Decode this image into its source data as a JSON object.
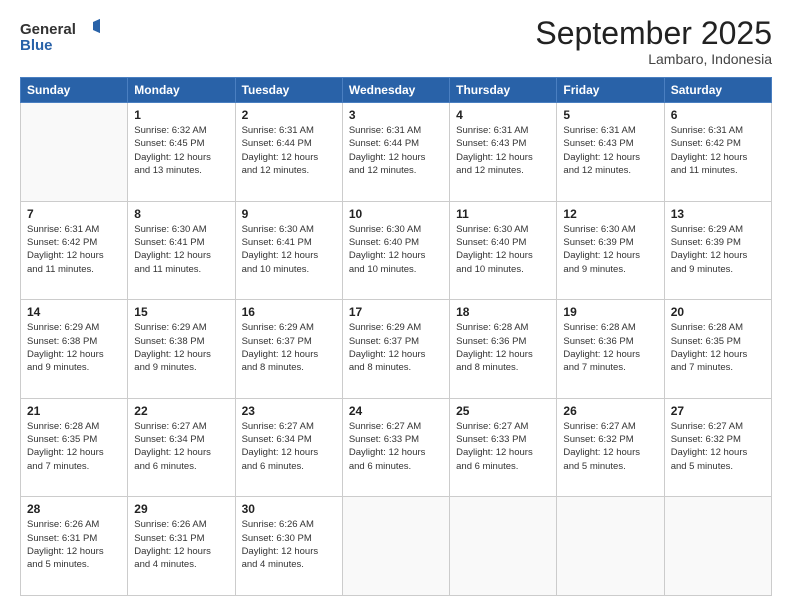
{
  "header": {
    "logo_line1": "General",
    "logo_line2": "Blue",
    "month": "September 2025",
    "location": "Lambaro, Indonesia"
  },
  "days_of_week": [
    "Sunday",
    "Monday",
    "Tuesday",
    "Wednesday",
    "Thursday",
    "Friday",
    "Saturday"
  ],
  "weeks": [
    [
      {
        "day": "",
        "info": ""
      },
      {
        "day": "1",
        "info": "Sunrise: 6:32 AM\nSunset: 6:45 PM\nDaylight: 12 hours\nand 13 minutes."
      },
      {
        "day": "2",
        "info": "Sunrise: 6:31 AM\nSunset: 6:44 PM\nDaylight: 12 hours\nand 12 minutes."
      },
      {
        "day": "3",
        "info": "Sunrise: 6:31 AM\nSunset: 6:44 PM\nDaylight: 12 hours\nand 12 minutes."
      },
      {
        "day": "4",
        "info": "Sunrise: 6:31 AM\nSunset: 6:43 PM\nDaylight: 12 hours\nand 12 minutes."
      },
      {
        "day": "5",
        "info": "Sunrise: 6:31 AM\nSunset: 6:43 PM\nDaylight: 12 hours\nand 12 minutes."
      },
      {
        "day": "6",
        "info": "Sunrise: 6:31 AM\nSunset: 6:42 PM\nDaylight: 12 hours\nand 11 minutes."
      }
    ],
    [
      {
        "day": "7",
        "info": "Sunrise: 6:31 AM\nSunset: 6:42 PM\nDaylight: 12 hours\nand 11 minutes."
      },
      {
        "day": "8",
        "info": "Sunrise: 6:30 AM\nSunset: 6:41 PM\nDaylight: 12 hours\nand 11 minutes."
      },
      {
        "day": "9",
        "info": "Sunrise: 6:30 AM\nSunset: 6:41 PM\nDaylight: 12 hours\nand 10 minutes."
      },
      {
        "day": "10",
        "info": "Sunrise: 6:30 AM\nSunset: 6:40 PM\nDaylight: 12 hours\nand 10 minutes."
      },
      {
        "day": "11",
        "info": "Sunrise: 6:30 AM\nSunset: 6:40 PM\nDaylight: 12 hours\nand 10 minutes."
      },
      {
        "day": "12",
        "info": "Sunrise: 6:30 AM\nSunset: 6:39 PM\nDaylight: 12 hours\nand 9 minutes."
      },
      {
        "day": "13",
        "info": "Sunrise: 6:29 AM\nSunset: 6:39 PM\nDaylight: 12 hours\nand 9 minutes."
      }
    ],
    [
      {
        "day": "14",
        "info": "Sunrise: 6:29 AM\nSunset: 6:38 PM\nDaylight: 12 hours\nand 9 minutes."
      },
      {
        "day": "15",
        "info": "Sunrise: 6:29 AM\nSunset: 6:38 PM\nDaylight: 12 hours\nand 9 minutes."
      },
      {
        "day": "16",
        "info": "Sunrise: 6:29 AM\nSunset: 6:37 PM\nDaylight: 12 hours\nand 8 minutes."
      },
      {
        "day": "17",
        "info": "Sunrise: 6:29 AM\nSunset: 6:37 PM\nDaylight: 12 hours\nand 8 minutes."
      },
      {
        "day": "18",
        "info": "Sunrise: 6:28 AM\nSunset: 6:36 PM\nDaylight: 12 hours\nand 8 minutes."
      },
      {
        "day": "19",
        "info": "Sunrise: 6:28 AM\nSunset: 6:36 PM\nDaylight: 12 hours\nand 7 minutes."
      },
      {
        "day": "20",
        "info": "Sunrise: 6:28 AM\nSunset: 6:35 PM\nDaylight: 12 hours\nand 7 minutes."
      }
    ],
    [
      {
        "day": "21",
        "info": "Sunrise: 6:28 AM\nSunset: 6:35 PM\nDaylight: 12 hours\nand 7 minutes."
      },
      {
        "day": "22",
        "info": "Sunrise: 6:27 AM\nSunset: 6:34 PM\nDaylight: 12 hours\nand 6 minutes."
      },
      {
        "day": "23",
        "info": "Sunrise: 6:27 AM\nSunset: 6:34 PM\nDaylight: 12 hours\nand 6 minutes."
      },
      {
        "day": "24",
        "info": "Sunrise: 6:27 AM\nSunset: 6:33 PM\nDaylight: 12 hours\nand 6 minutes."
      },
      {
        "day": "25",
        "info": "Sunrise: 6:27 AM\nSunset: 6:33 PM\nDaylight: 12 hours\nand 6 minutes."
      },
      {
        "day": "26",
        "info": "Sunrise: 6:27 AM\nSunset: 6:32 PM\nDaylight: 12 hours\nand 5 minutes."
      },
      {
        "day": "27",
        "info": "Sunrise: 6:27 AM\nSunset: 6:32 PM\nDaylight: 12 hours\nand 5 minutes."
      }
    ],
    [
      {
        "day": "28",
        "info": "Sunrise: 6:26 AM\nSunset: 6:31 PM\nDaylight: 12 hours\nand 5 minutes."
      },
      {
        "day": "29",
        "info": "Sunrise: 6:26 AM\nSunset: 6:31 PM\nDaylight: 12 hours\nand 4 minutes."
      },
      {
        "day": "30",
        "info": "Sunrise: 6:26 AM\nSunset: 6:30 PM\nDaylight: 12 hours\nand 4 minutes."
      },
      {
        "day": "",
        "info": ""
      },
      {
        "day": "",
        "info": ""
      },
      {
        "day": "",
        "info": ""
      },
      {
        "day": "",
        "info": ""
      }
    ]
  ]
}
